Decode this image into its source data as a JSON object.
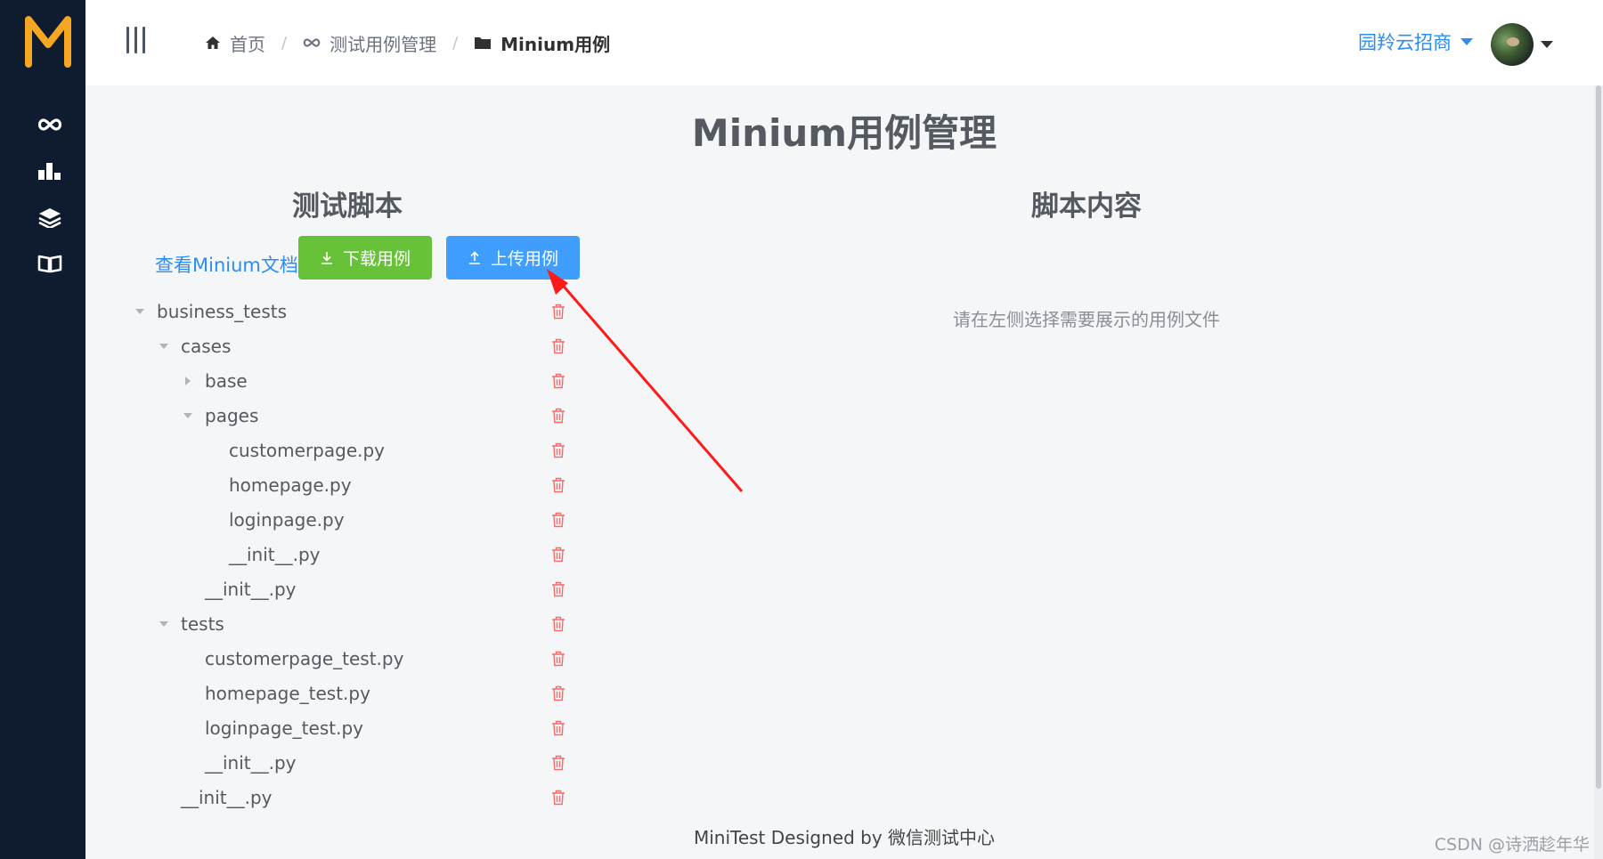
{
  "sidebar": {
    "logo_letter": "M",
    "icons": [
      "infinity-icon",
      "chart-bar-icon",
      "layers-icon",
      "book-icon"
    ]
  },
  "header": {
    "breadcrumbs": [
      {
        "label": "首页",
        "icon": "home-icon"
      },
      {
        "label": "测试用例管理",
        "icon": "infinity-icon"
      },
      {
        "label": "Minium用例",
        "icon": "folder-icon"
      }
    ],
    "separator": "/",
    "user_name": "园羚云招商"
  },
  "main": {
    "title": "Minium用例管理",
    "left_title": "测试脚本",
    "right_title": "脚本内容",
    "doc_link": "查看Minium文档",
    "download_label": "下载用例",
    "upload_label": "上传用例",
    "empty_tip": "请在左侧选择需要展示的用例文件",
    "tree": [
      {
        "label": "business_tests",
        "level": 0,
        "state": "expanded"
      },
      {
        "label": "cases",
        "level": 1,
        "state": "expanded"
      },
      {
        "label": "base",
        "level": 2,
        "state": "collapsed"
      },
      {
        "label": "pages",
        "level": 2,
        "state": "expanded"
      },
      {
        "label": "customerpage.py",
        "level": 3,
        "state": "leaf"
      },
      {
        "label": "homepage.py",
        "level": 3,
        "state": "leaf"
      },
      {
        "label": "loginpage.py",
        "level": 3,
        "state": "leaf"
      },
      {
        "label": "__init__.py",
        "level": 3,
        "state": "leaf"
      },
      {
        "label": "__init__.py",
        "level": 2,
        "state": "leaf"
      },
      {
        "label": "tests",
        "level": 1,
        "state": "expanded"
      },
      {
        "label": "customerpage_test.py",
        "level": 2,
        "state": "leaf"
      },
      {
        "label": "homepage_test.py",
        "level": 2,
        "state": "leaf"
      },
      {
        "label": "loginpage_test.py",
        "level": 2,
        "state": "leaf"
      },
      {
        "label": "__init__.py",
        "level": 2,
        "state": "leaf"
      },
      {
        "label": "__init__.py",
        "level": 1,
        "state": "leaf"
      }
    ]
  },
  "footer": {
    "text": "MiniTest Designed by 微信测试中心"
  },
  "watermark": "CSDN @诗洒趁年华",
  "colors": {
    "sidebar_bg": "#0f1b2e",
    "accent_blue": "#409eff",
    "accent_green": "#67c23a",
    "danger": "#f56c6c",
    "logo_orange": "#f5a623",
    "annotation_red": "#ff1a1a"
  }
}
